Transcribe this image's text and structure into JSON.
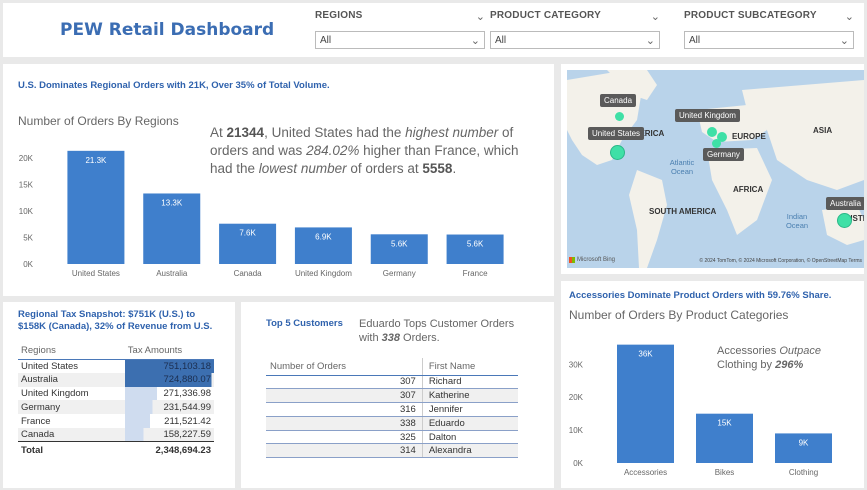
{
  "header": {
    "title": "PEW Retail Dashboard",
    "slicers": [
      {
        "label": "REGIONS",
        "value": "All"
      },
      {
        "label": "PRODUCT CATEGORY",
        "value": "All"
      },
      {
        "label": "PRODUCT SUBCATEGORY",
        "value": "All"
      }
    ]
  },
  "regions_panel": {
    "headline": "U.S. Dominates Regional Orders with 21K, Over 35% of Total Volume.",
    "subtitle": "Number of Orders By Regions",
    "narrative": {
      "p1": "At ",
      "v1": "21344",
      "p2": ", United States had the ",
      "i1": "highest number",
      "p3": " of orders and was ",
      "i2": "284.02%",
      "p4": " higher than France, which had the ",
      "i3": "lowest number",
      "p5": " of orders at ",
      "v2": "5558",
      "p6": "."
    }
  },
  "map_panel": {
    "countries": [
      "Canada",
      "United States",
      "United Kingdom",
      "Germany",
      "Australia"
    ],
    "labels": [
      "AMERICA",
      "EUROPE",
      "ASIA",
      "AFRICA",
      "SOUTH AMERICA",
      "AUSTR"
    ],
    "oceans": [
      "Atlantic Ocean",
      "Indian Ocean"
    ],
    "footer_left": "Microsoft Bing",
    "footer_right": "© 2024 TomTom, © 2024 Microsoft Corporation, © OpenStreetMap  Terms"
  },
  "tax_panel": {
    "headline": "Regional Tax Snapshot: $751K (U.S.) to $158K (Canada), 32% of Revenue from U.S.",
    "col_region": "Regions",
    "col_amount": "Tax Amounts",
    "rows": [
      {
        "region": "United States",
        "amount": "751,103.18"
      },
      {
        "region": "Australia",
        "amount": "724,880.07"
      },
      {
        "region": "United Kingdom",
        "amount": "271,336.98"
      },
      {
        "region": "Germany",
        "amount": "231,544.99"
      },
      {
        "region": "France",
        "amount": "211,521.42"
      },
      {
        "region": "Canada",
        "amount": "158,227.59"
      }
    ],
    "total_label": "Total",
    "total_amount": "2,348,694.23",
    "bar_fraction": [
      1.0,
      0.965,
      0.361,
      0.308,
      0.282,
      0.211
    ]
  },
  "customers_panel": {
    "headline": "Top 5 Customers",
    "note_prefix": "Eduardo Tops Customer Orders with ",
    "note_value": "338",
    "note_suffix": " Orders.",
    "col_orders": "Number of Orders",
    "col_name": "First Name",
    "rows": [
      {
        "orders": "307",
        "name": "Richard"
      },
      {
        "orders": "307",
        "name": "Katherine"
      },
      {
        "orders": "316",
        "name": "Jennifer"
      },
      {
        "orders": "338",
        "name": "Eduardo"
      },
      {
        "orders": "325",
        "name": "Dalton"
      },
      {
        "orders": "314",
        "name": "Alexandra"
      }
    ]
  },
  "categories_panel": {
    "headline": "Accessories Dominate Product Orders with 59.76% Share.",
    "subtitle": "Number of Orders By Product Categories",
    "note_l1": "Accessories ",
    "note_l1i": "Outpace",
    "note_l2": "Clothing by ",
    "note_l2b": "296%"
  },
  "colors": {
    "bar": "#3f7fcc",
    "accent": "#2f62ad",
    "highlight": "#3c6fb0",
    "light": "#cfdcef"
  },
  "chart_data": [
    {
      "type": "bar",
      "title": "Number of Orders By Regions",
      "categories": [
        "United States",
        "Australia",
        "Canada",
        "United Kingdom",
        "Germany",
        "France"
      ],
      "values": [
        21344,
        13300,
        7600,
        6900,
        5600,
        5558
      ],
      "data_labels": [
        "21.3K",
        "13.3K",
        "7.6K",
        "6.9K",
        "5.6K",
        "5.6K"
      ],
      "yticks": [
        "0K",
        "5K",
        "10K",
        "15K",
        "20K"
      ],
      "ylim": [
        0,
        21500
      ],
      "grid": false
    },
    {
      "type": "bar",
      "title": "Number of Orders By Product Categories",
      "categories": [
        "Accessories",
        "Bikes",
        "Clothing"
      ],
      "values": [
        36000,
        15000,
        9000
      ],
      "data_labels": [
        "36K",
        "15K",
        "9K"
      ],
      "yticks": [
        "0K",
        "10K",
        "20K",
        "30K"
      ],
      "ylim": [
        0,
        36500
      ],
      "grid": false
    }
  ]
}
